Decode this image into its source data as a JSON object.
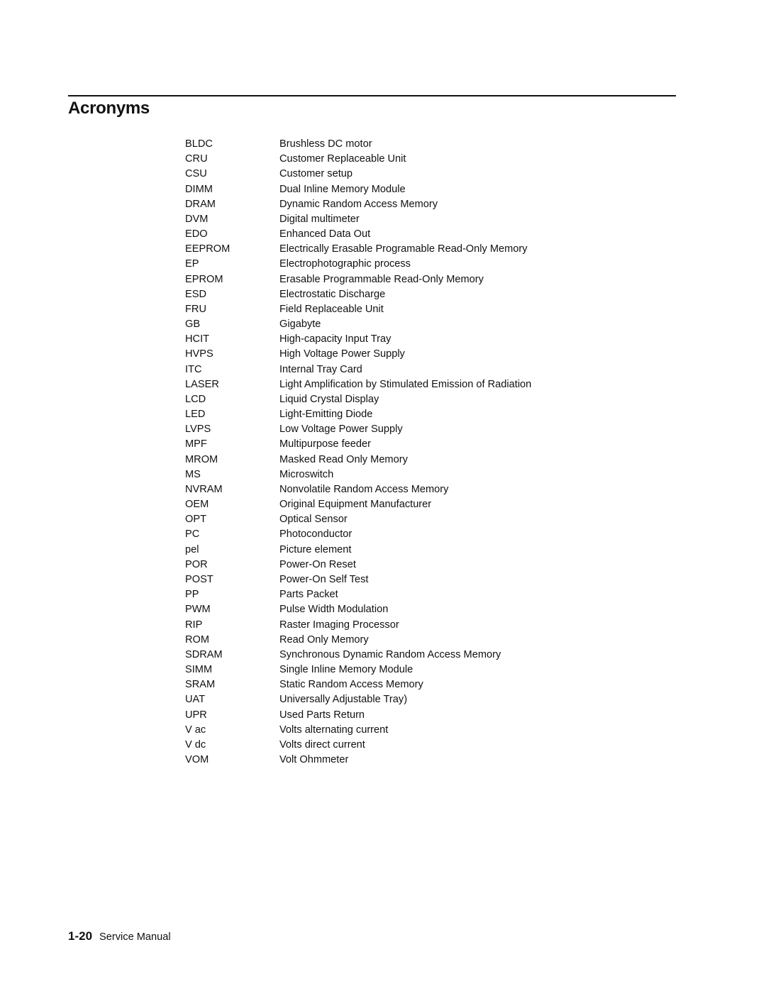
{
  "page": {
    "title": "Acronyms",
    "footer": {
      "page_number": "1-20",
      "manual_name": "Service Manual"
    }
  },
  "acronyms": [
    {
      "term": "BLDC",
      "definition": "Brushless DC motor"
    },
    {
      "term": "CRU",
      "definition": "Customer Replaceable Unit"
    },
    {
      "term": "CSU",
      "definition": "Customer setup"
    },
    {
      "term": "DIMM",
      "definition": "Dual Inline Memory Module"
    },
    {
      "term": "DRAM",
      "definition": "Dynamic Random Access Memory"
    },
    {
      "term": "DVM",
      "definition": "Digital multimeter"
    },
    {
      "term": "EDO",
      "definition": "Enhanced Data Out"
    },
    {
      "term": "EEPROM",
      "definition": "Electrically Erasable Programable Read-Only Memory"
    },
    {
      "term": "EP",
      "definition": "Electrophotographic process"
    },
    {
      "term": "EPROM",
      "definition": "Erasable Programmable Read-Only Memory"
    },
    {
      "term": "ESD",
      "definition": "Electrostatic Discharge"
    },
    {
      "term": "FRU",
      "definition": "Field Replaceable Unit"
    },
    {
      "term": "GB",
      "definition": "Gigabyte"
    },
    {
      "term": "HCIT",
      "definition": "High-capacity Input Tray"
    },
    {
      "term": "HVPS",
      "definition": "High Voltage Power Supply"
    },
    {
      "term": "ITC",
      "definition": "Internal Tray Card"
    },
    {
      "term": "LASER",
      "definition": "Light Amplification by Stimulated Emission of Radiation"
    },
    {
      "term": "LCD",
      "definition": "Liquid Crystal Display"
    },
    {
      "term": "LED",
      "definition": "Light-Emitting Diode"
    },
    {
      "term": "LVPS",
      "definition": "Low Voltage Power Supply"
    },
    {
      "term": "MPF",
      "definition": "Multipurpose feeder"
    },
    {
      "term": "MROM",
      "definition": "Masked Read Only Memory"
    },
    {
      "term": "MS",
      "definition": "Microswitch"
    },
    {
      "term": "NVRAM",
      "definition": "Nonvolatile Random Access Memory"
    },
    {
      "term": "OEM",
      "definition": "Original Equipment Manufacturer"
    },
    {
      "term": "OPT",
      "definition": "Optical Sensor"
    },
    {
      "term": "PC",
      "definition": "Photoconductor"
    },
    {
      "term": "pel",
      "definition": "Picture element"
    },
    {
      "term": "POR",
      "definition": "Power-On Reset"
    },
    {
      "term": "POST",
      "definition": "Power-On Self Test"
    },
    {
      "term": "PP",
      "definition": "Parts Packet"
    },
    {
      "term": "PWM",
      "definition": "Pulse Width Modulation"
    },
    {
      "term": "RIP",
      "definition": "Raster Imaging Processor"
    },
    {
      "term": "ROM",
      "definition": "Read Only Memory"
    },
    {
      "term": "SDRAM",
      "definition": "Synchronous Dynamic Random Access Memory"
    },
    {
      "term": "SIMM",
      "definition": "Single Inline Memory Module"
    },
    {
      "term": "SRAM",
      "definition": "Static Random Access Memory"
    },
    {
      "term": "UAT",
      "definition": "Universally Adjustable Tray)"
    },
    {
      "term": "UPR",
      "definition": "Used Parts Return"
    },
    {
      "term": "V ac",
      "definition": "Volts alternating current"
    },
    {
      "term": "V dc",
      "definition": "Volts direct current"
    },
    {
      "term": "VOM",
      "definition": "Volt Ohmmeter"
    }
  ]
}
